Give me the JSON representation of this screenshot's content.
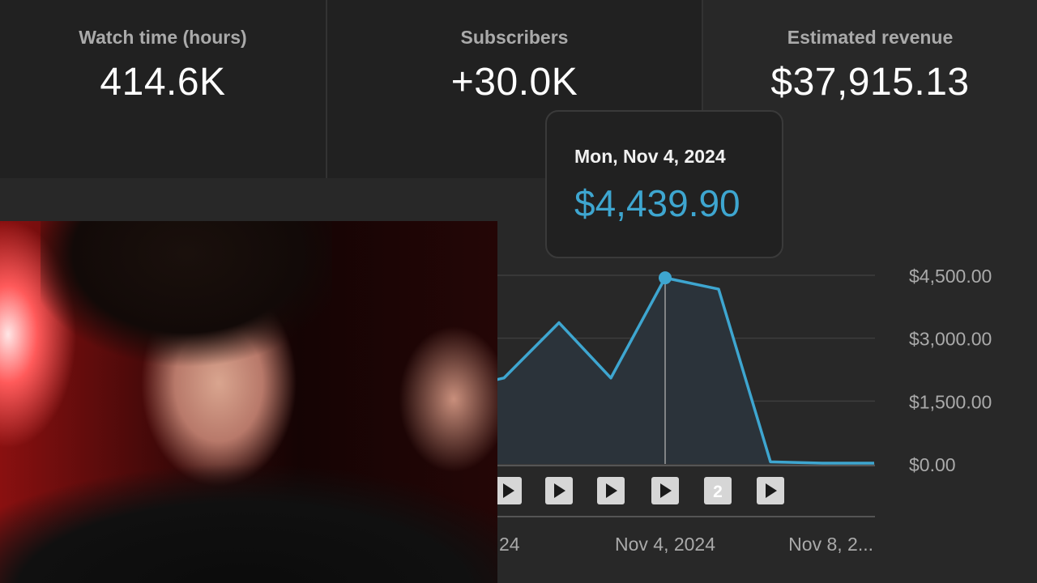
{
  "metrics": [
    {
      "label": "Watch time (hours)",
      "value": "414.6K"
    },
    {
      "label": "Subscribers",
      "value": "+30.0K"
    },
    {
      "label": "Estimated revenue",
      "value": "$37,915.13"
    }
  ],
  "tooltip": {
    "date": "Mon, Nov 4, 2024",
    "value": "$4,439.90"
  },
  "colors": {
    "accent": "#3ea6d0",
    "background": "#282828",
    "card": "#212121"
  },
  "chart_data": {
    "type": "area",
    "y_ticks": [
      "$4,500.00",
      "$3,000.00",
      "$1,500.00",
      "$0.00"
    ],
    "y_tick_values": [
      4500,
      3000,
      1500,
      0
    ],
    "ylim": [
      0,
      4500
    ],
    "x_tick_labels": [
      "Nov 4, 2024",
      "Nov 8, 2..."
    ],
    "x_partial_label": "24",
    "series": [
      {
        "values": [
          2050,
          3370,
          2050,
          4440,
          4170,
          50,
          20,
          20
        ]
      }
    ],
    "highlight_index": 3,
    "grid": true,
    "markers": [
      {
        "type": "video",
        "icon": "play-icon"
      },
      {
        "type": "video",
        "icon": "play-icon"
      },
      {
        "type": "video",
        "icon": "play-icon"
      },
      {
        "type": "video",
        "icon": "play-icon"
      },
      {
        "type": "group",
        "count": "2"
      },
      {
        "type": "video",
        "icon": "play-icon"
      }
    ]
  }
}
